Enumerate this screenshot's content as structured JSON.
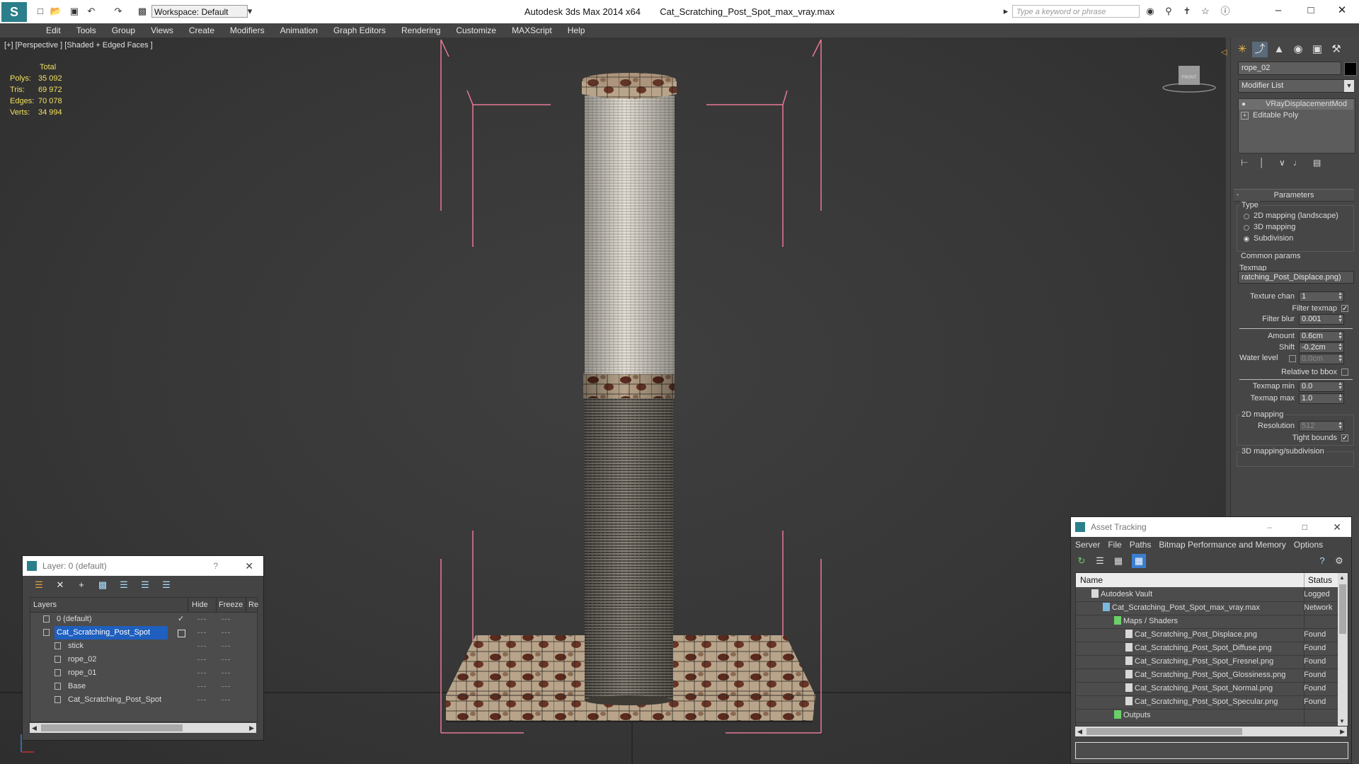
{
  "titlebar": {
    "app_title": "Autodesk 3ds Max  2014 x64",
    "file_title": "Cat_Scratching_Post_Spot_max_vray.max",
    "workspace": "Workspace: Default",
    "search_placeholder": "Type a keyword or phrase"
  },
  "menu": [
    "Edit",
    "Tools",
    "Group",
    "Views",
    "Create",
    "Modifiers",
    "Animation",
    "Graph Editors",
    "Rendering",
    "Customize",
    "MAXScript",
    "Help"
  ],
  "viewport": {
    "label": "[+] [Perspective ] [Shaded + Edged Faces ]",
    "stats": {
      "header": "Total",
      "rows": [
        {
          "label": "Polys:",
          "value": "35 092"
        },
        {
          "label": "Tris:",
          "value": "69 972"
        },
        {
          "label": "Edges:",
          "value": "70 078"
        },
        {
          "label": "Verts:",
          "value": "34 994"
        }
      ]
    },
    "viewcube_label": "FRONT"
  },
  "command_panel": {
    "object_name": "rope_02",
    "modifier_list": "Modifier List",
    "stack": [
      "VRayDisplacementMod",
      "Editable Poly"
    ],
    "rollout_title": "Parameters",
    "type_group": "Type",
    "type_options": [
      "2D mapping (landscape)",
      "3D mapping",
      "Subdivision"
    ],
    "type_selected": 2,
    "common_params": "Common params",
    "texmap_label": "Texmap",
    "texmap_value": "ratching_Post_Displace.png)",
    "texture_chan_label": "Texture chan",
    "texture_chan": "1",
    "filter_texmap_label": "Filter texmap",
    "filter_blur_label": "Filter blur",
    "filter_blur": "0.001",
    "amount_label": "Amount",
    "amount": "0.6cm",
    "shift_label": "Shift",
    "shift": "-0.2cm",
    "water_label": "Water level",
    "water": "0.0cm",
    "relative_label": "Relative to bbox",
    "texmap_min_label": "Texmap min",
    "texmap_min": "0.0",
    "texmap_max_label": "Texmap max",
    "texmap_max": "1.0",
    "mapping2d": "2D mapping",
    "resolution_label": "Resolution",
    "resolution": "512",
    "tight_label": "Tight bounds",
    "mapping3d": "3D mapping/subdivision"
  },
  "layer_dialog": {
    "title": "Layer: 0 (default)",
    "columns": [
      "Layers",
      "Hide",
      "Freeze",
      "Re"
    ],
    "rows": [
      {
        "name": "0 (default)",
        "indent": 0,
        "selected": false,
        "current": true
      },
      {
        "name": "Cat_Scratching_Post_Spot",
        "indent": 0,
        "selected": true,
        "current": false
      },
      {
        "name": "stick",
        "indent": 1,
        "selected": false,
        "current": false
      },
      {
        "name": "rope_02",
        "indent": 1,
        "selected": false,
        "current": false
      },
      {
        "name": "rope_01",
        "indent": 1,
        "selected": false,
        "current": false
      },
      {
        "name": "Base",
        "indent": 1,
        "selected": false,
        "current": false
      },
      {
        "name": "Cat_Scratching_Post_Spot",
        "indent": 1,
        "selected": false,
        "current": false
      }
    ]
  },
  "asset_dialog": {
    "title": "Asset Tracking",
    "menu": [
      "Server",
      "File",
      "Paths",
      "Bitmap Performance and Memory",
      "Options"
    ],
    "col_name": "Name",
    "col_status": "Status",
    "rows": [
      {
        "name": "Autodesk Vault",
        "status": "Logged",
        "indent": 1
      },
      {
        "name": "Cat_Scratching_Post_Spot_max_vray.max",
        "status": "Network",
        "indent": 2
      },
      {
        "name": "Maps / Shaders",
        "status": "",
        "indent": 3
      },
      {
        "name": "Cat_Scratching_Post_Displace.png",
        "status": "Found",
        "indent": 4
      },
      {
        "name": "Cat_Scratching_Post_Spot_Diffuse.png",
        "status": "Found",
        "indent": 4
      },
      {
        "name": "Cat_Scratching_Post_Spot_Fresnel.png",
        "status": "Found",
        "indent": 4
      },
      {
        "name": "Cat_Scratching_Post_Spot_Glossiness.png",
        "status": "Found",
        "indent": 4
      },
      {
        "name": "Cat_Scratching_Post_Spot_Normal.png",
        "status": "Found",
        "indent": 4
      },
      {
        "name": "Cat_Scratching_Post_Spot_Specular.png",
        "status": "Found",
        "indent": 4
      },
      {
        "name": "Outputs",
        "status": "",
        "indent": 3
      }
    ]
  },
  "colors": {
    "accent": "#0078d7",
    "stats": "#f0e060",
    "bracket": "#e87896",
    "selected_row": "#1f5fbf"
  }
}
